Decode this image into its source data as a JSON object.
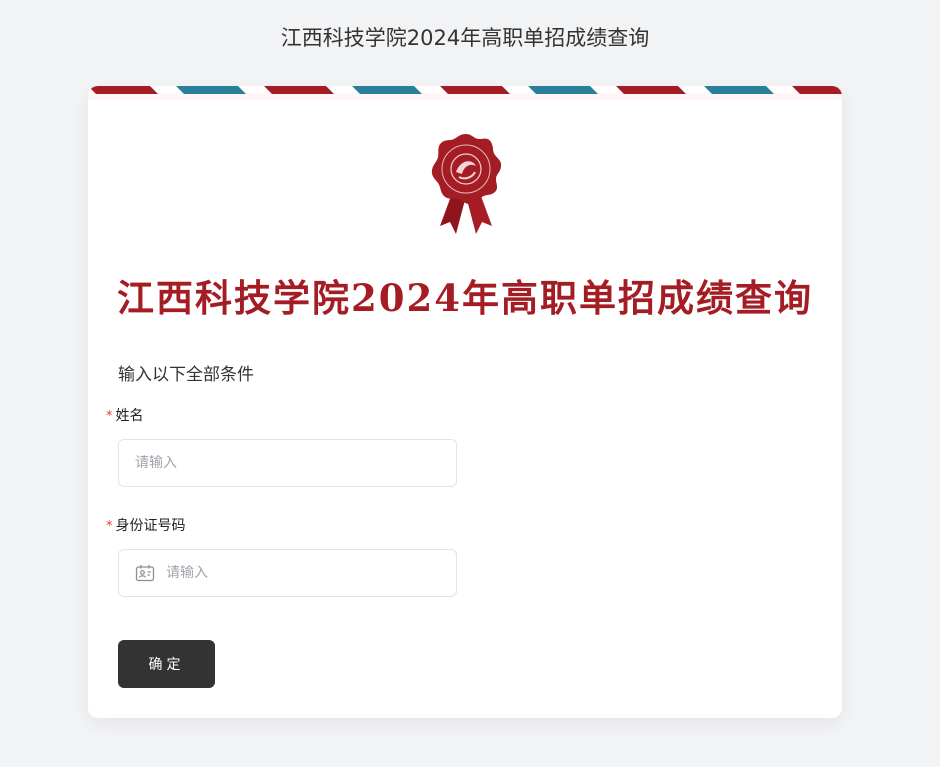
{
  "page": {
    "title": "江西科技学院2024年高职单招成绩查询"
  },
  "card": {
    "banner_title": "江西科技学院2024年高职单招成绩查询",
    "instruction": "输入以下全部条件",
    "fields": [
      {
        "label": "姓名",
        "required_mark": "*",
        "placeholder": "请输入",
        "value": "",
        "icon": null
      },
      {
        "label": "身份证号码",
        "required_mark": "*",
        "placeholder": "请输入",
        "value": "",
        "icon": "id-card-icon"
      }
    ],
    "submit_label": "确定"
  },
  "colors": {
    "accent_red": "#a51d24",
    "stripe_blue": "#2a7f9a",
    "button_dark": "#333333",
    "required_red": "#e0413d",
    "background": "#f2f3f5"
  },
  "icons": {
    "seal": "wax-seal-ribbon-icon",
    "id_card": "id-card-icon"
  }
}
